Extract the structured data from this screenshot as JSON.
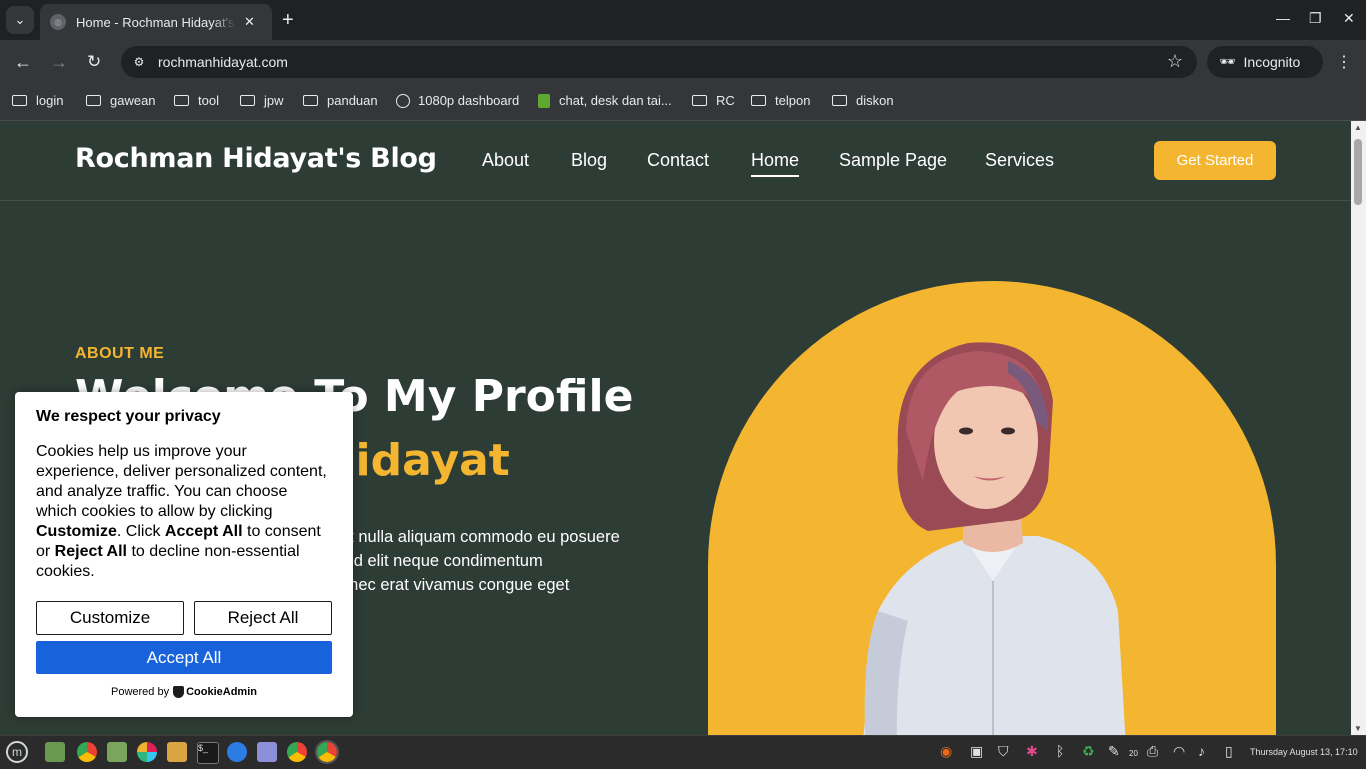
{
  "browser": {
    "tab_title": "Home - Rochman Hidayat's Blog",
    "url": "rochmanhidayat.com",
    "profile_label": "Incognito",
    "bookmarks": [
      {
        "label": "login",
        "icon": "folder-icon"
      },
      {
        "label": "gawean",
        "icon": "folder-icon"
      },
      {
        "label": "tool",
        "icon": "folder-icon"
      },
      {
        "label": "jpw",
        "icon": "folder-icon"
      },
      {
        "label": "panduan",
        "icon": "folder-icon"
      },
      {
        "label": "1080p dashboard",
        "icon": "globe-icon"
      },
      {
        "label": "chat, desk dan tai...",
        "icon": "shopify-icon"
      },
      {
        "label": "RC",
        "icon": "folder-icon"
      },
      {
        "label": "telpon",
        "icon": "folder-icon"
      },
      {
        "label": "diskon",
        "icon": "folder-icon"
      }
    ]
  },
  "site": {
    "brand": "Rochman Hidayat's Blog",
    "nav": [
      "About",
      "Blog",
      "Contact",
      "Home",
      "Sample Page",
      "Services"
    ],
    "active_nav": "Home",
    "cta_label": "Get Started",
    "hero": {
      "eyebrow": "ABOUT ME",
      "headline_line1": "Welcome To My Profile",
      "headline_line2": "Rochman Hidayat",
      "intro_lines": [
        "et nulla aliquam commodo eu posuere",
        "r id elit neque condimentum",
        "onec erat vivamus congue eget"
      ]
    },
    "colors": {
      "accent": "#f4b630",
      "background": "#2e3c36"
    }
  },
  "cookie_banner": {
    "title": "We respect your privacy",
    "text_1": "Cookies help us improve your experience, deliver personalized content, and analyze traffic. You can choose which cookies to allow by clicking ",
    "bold_customize": "Customize",
    "text_2": ". Click ",
    "bold_accept": "Accept All",
    "text_3": " to consent or ",
    "bold_reject": "Reject All",
    "text_4": " to decline non-essential cookies.",
    "customize_label": "Customize",
    "reject_label": "Reject All",
    "accept_label": "Accept All",
    "powered_by": "Powered by",
    "brand": "CookieAdmin"
  },
  "taskbar": {
    "notification_count": "20",
    "clock": "Thursday August 13, 17:10"
  }
}
